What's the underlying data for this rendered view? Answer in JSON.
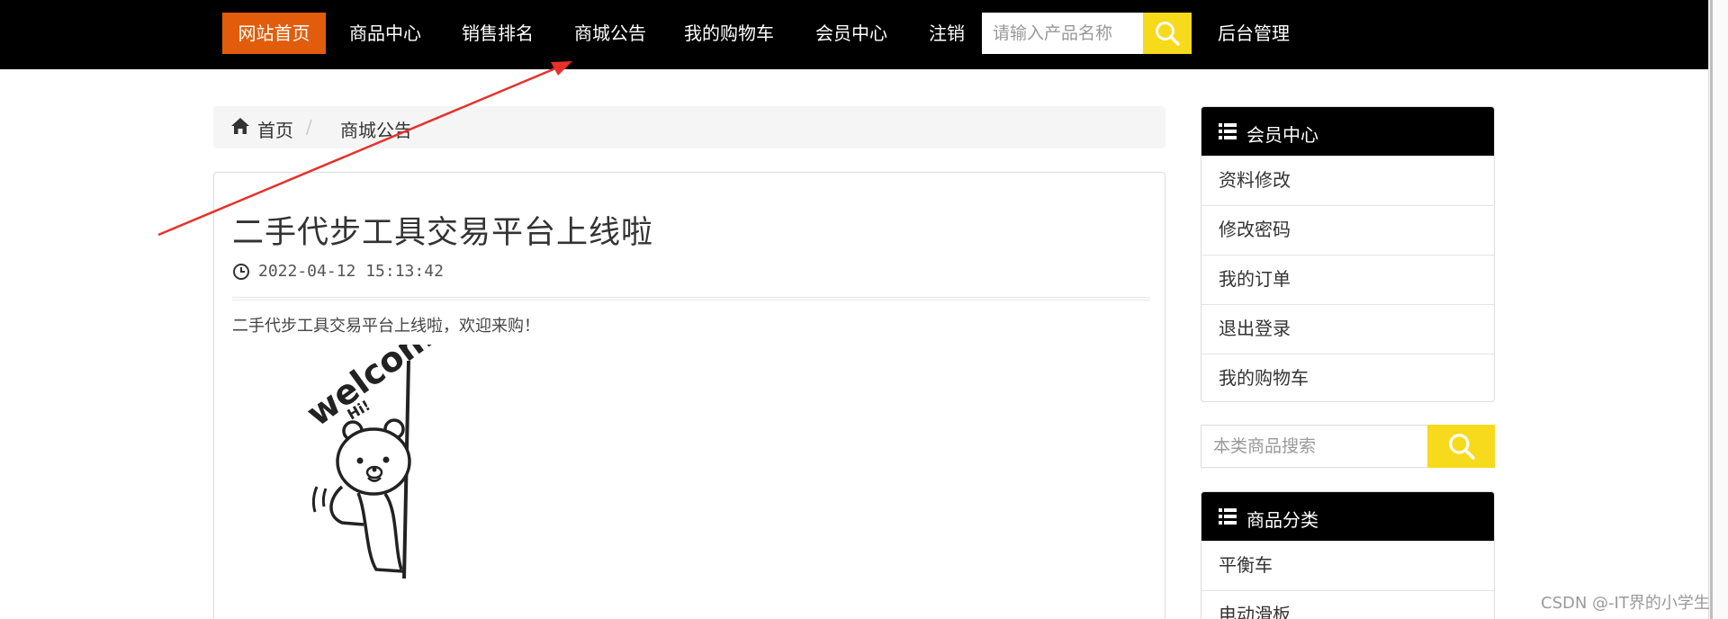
{
  "nav": {
    "items": [
      {
        "label": "网站首页",
        "active": true
      },
      {
        "label": "商品中心"
      },
      {
        "label": "销售排名"
      },
      {
        "label": "商城公告"
      },
      {
        "label": "我的购物车"
      },
      {
        "label": "会员中心"
      },
      {
        "label": "注销"
      }
    ],
    "search_placeholder": "请输入产品名称",
    "admin_label": "后台管理"
  },
  "breadcrumb": {
    "home": "首页",
    "separator": "/",
    "current": "商城公告"
  },
  "article": {
    "title": "二手代步工具交易平台上线啦",
    "date": "2022-04-12 15:13:42",
    "body": "二手代步工具交易平台上线啦，欢迎来购！",
    "image_text": "welcome!",
    "image_subtext": "Hi!"
  },
  "member_panel": {
    "title": "会员中心",
    "links": [
      "资料修改",
      "修改密码",
      "我的订单",
      "退出登录",
      "我的购物车"
    ]
  },
  "side_search": {
    "placeholder": "本类商品搜索"
  },
  "category_panel": {
    "title": "商品分类",
    "links": [
      "平衡车",
      "电动滑板"
    ]
  },
  "watermark": "CSDN @-IT界的小学生",
  "colors": {
    "nav_bg": "#000000",
    "active_bg": "#e15d0c",
    "search_button": "#f7da1c",
    "annotation_arrow": "#e8302a"
  },
  "icons": [
    "search-icon",
    "home-icon",
    "clock-icon",
    "list-icon"
  ]
}
